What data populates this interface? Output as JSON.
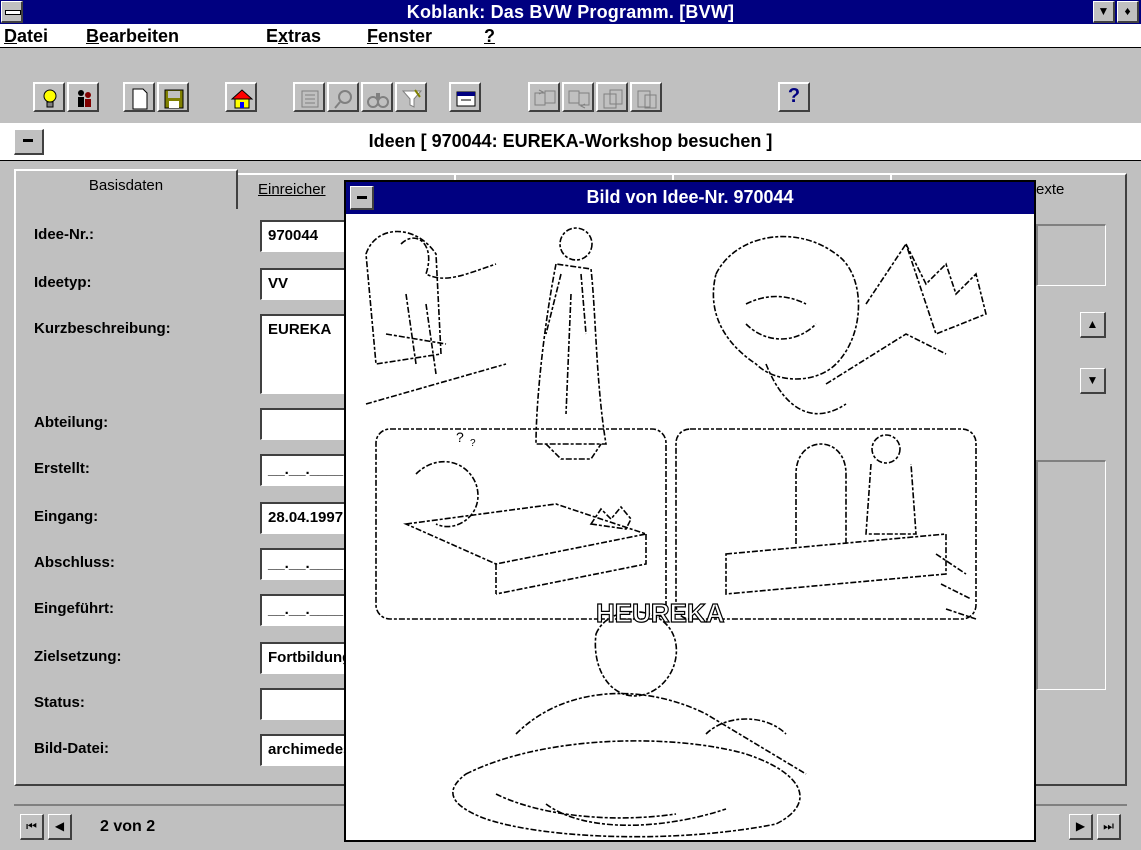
{
  "app": {
    "title": "Koblank: Das BVW Programm. [BVW]"
  },
  "menu": [
    {
      "label": "Datei",
      "key": "D",
      "rest": "atei"
    },
    {
      "label": "Bearbeiten",
      "key": "B",
      "rest": "earbeiten"
    },
    {
      "label": "Extras",
      "pre": "E",
      "key": "x",
      "rest": "tras"
    },
    {
      "label": "Fenster",
      "key": "F",
      "rest": "enster"
    },
    {
      "label": "?",
      "key": "?",
      "rest": ""
    }
  ],
  "toolbar": {
    "help_symbol": "?",
    "icons": [
      "lightbulb-icon",
      "people-icon",
      "new-document-icon",
      "save-icon",
      "home-icon",
      "list-icon",
      "search-icon",
      "binoculars-icon",
      "filter-icon",
      "window-icon",
      "swap-left-icon",
      "swap-right-icon",
      "copy-icon",
      "paste-icon",
      "help-icon"
    ]
  },
  "window": {
    "title": "Ideen  [ 970044: EUREKA-Workshop besuchen ]"
  },
  "tabs": [
    {
      "label": "Basisdaten"
    },
    {
      "label": "Einreicher"
    },
    {
      "label": "exte"
    }
  ],
  "form": {
    "rows": [
      {
        "label": "Idee-Nr.:",
        "value": "970044"
      },
      {
        "label": "Ideetyp:",
        "value": "VV"
      },
      {
        "label": "Kurzbeschreibung:",
        "value": "EUREKA"
      },
      {
        "label": "Abteilung:",
        "value": ""
      },
      {
        "label": "Erstellt:",
        "value": "__.__.____"
      },
      {
        "label": "Eingang:",
        "value": "28.04.1997"
      },
      {
        "label": "Abschluss:",
        "value": "__.__.____"
      },
      {
        "label": "Eingeführt:",
        "value": "__.__.____"
      },
      {
        "label": "Zielsetzung:",
        "value": "Fortbildung"
      },
      {
        "label": "Status:",
        "value": ""
      },
      {
        "label": "Bild-Datei:",
        "value": "archimedes.bmp"
      }
    ]
  },
  "navigation": {
    "record_text": "2 von 2"
  },
  "popup": {
    "title": "Bild von Idee-Nr. 970044",
    "image_text": "HEUREKA"
  }
}
